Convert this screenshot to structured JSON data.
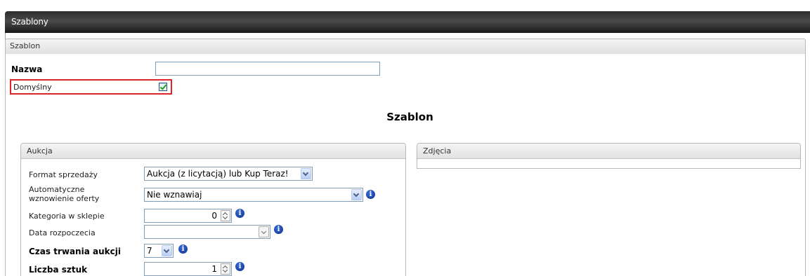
{
  "window": {
    "title": "Szablony"
  },
  "section": {
    "title": "Szablon"
  },
  "form": {
    "name_label": "Nazwa",
    "name_value": "",
    "default_label": "Domyślny",
    "default_checked": true
  },
  "heading": "Szablon",
  "auction_panel": {
    "title": "Aukcja",
    "fields": {
      "format_label": "Format sprzedaży",
      "format_value": "Aukcja (z licytacją) lub Kup Teraz!",
      "renew_label_line1": "Automatyczne",
      "renew_label_line2": "wznowienie oferty",
      "renew_value": "Nie wznawiaj",
      "category_label": "Kategoria w sklepie",
      "category_value": "0",
      "start_label": "Data rozpoczecia",
      "start_value": "",
      "duration_label": "Czas trwania aukcji",
      "duration_value": "7",
      "quantity_label": "Liczba sztuk",
      "quantity_value": "1"
    }
  },
  "photos_panel": {
    "title": "Zdjęcia"
  },
  "icons": {
    "info_glyph": "i"
  },
  "colors": {
    "highlight": "#e0242c",
    "titlebar": "#2c2c2c",
    "info_icon": "#0a2f8c"
  }
}
